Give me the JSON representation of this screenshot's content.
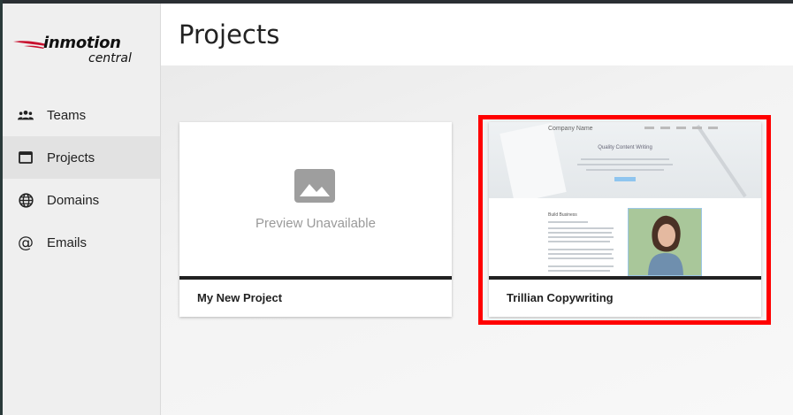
{
  "brand": {
    "logo_main": "inmotion",
    "logo_sub": "central",
    "accent_color": "#c8102e"
  },
  "sidebar": {
    "items": [
      {
        "label": "Teams",
        "icon": "people-icon",
        "active": false
      },
      {
        "label": "Projects",
        "icon": "browser-window-icon",
        "active": true
      },
      {
        "label": "Domains",
        "icon": "globe-icon",
        "active": false
      },
      {
        "label": "Emails",
        "icon": "at-sign-icon",
        "active": false
      }
    ]
  },
  "header": {
    "title": "Projects"
  },
  "projects": [
    {
      "name": "My New Project",
      "preview_text": "Preview Unavailable",
      "has_preview": false
    },
    {
      "name": "Trillian Copywriting",
      "has_preview": true,
      "highlighted": true,
      "thumbnail": {
        "site_title": "Company Name",
        "headline": "Quality Content Writing",
        "section_title": "Build Business"
      }
    }
  ],
  "colors": {
    "highlight": "#ff0000",
    "card_divider": "#222222"
  }
}
